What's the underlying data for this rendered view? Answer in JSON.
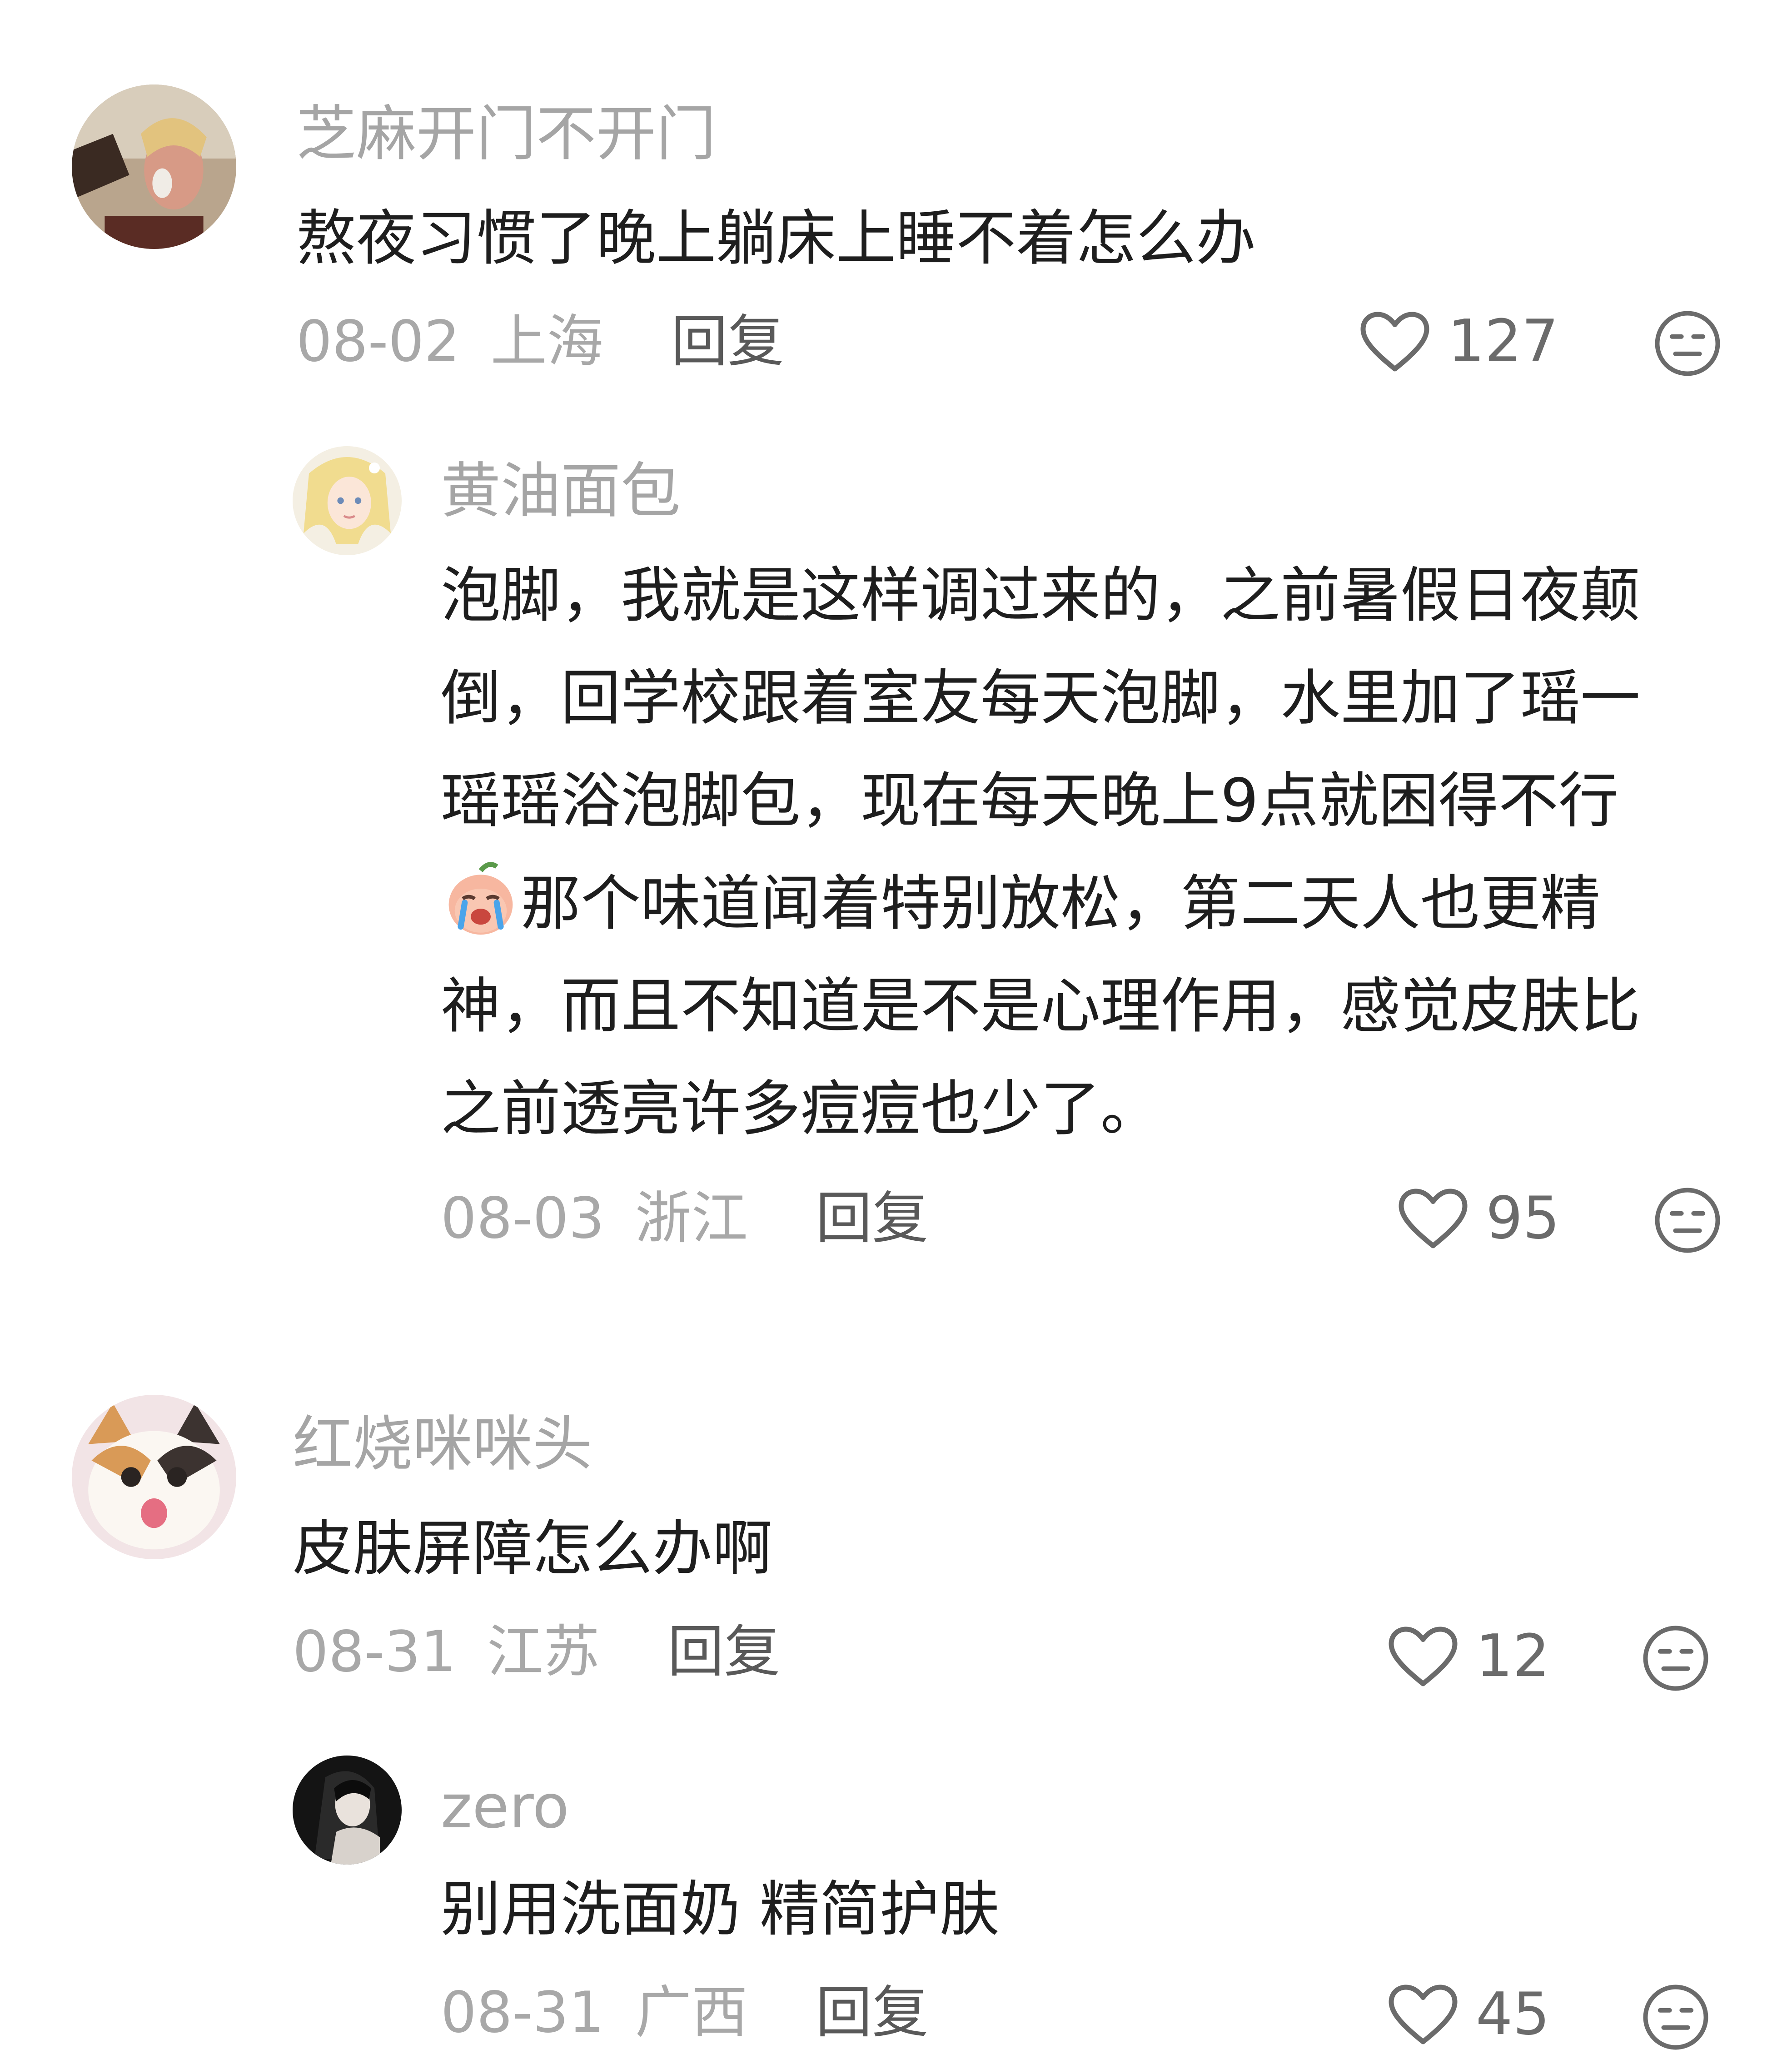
{
  "comments": [
    {
      "username": "芝麻开门不开门",
      "text": "熬夜习惯了晚上躺床上睡不着怎么办",
      "date": "08-02",
      "location": "上海",
      "reply_label": "回复",
      "likes": "127",
      "avatar_icon": "user-avatar-photo",
      "replies": [
        {
          "username": "黄油面包",
          "text_part1": "泡脚，我就是这样调过来的，之前暑假日夜颠倒，回学校跟着室友每天泡脚，水里加了瑶一瑶瑶浴泡脚包，现在每天晚上9点就困得不行",
          "text_part2": "那个味道闻着特别放松，第二天人也更精神，而且不知道是不是心理作用，感觉皮肤比之前透亮许多痘痘也少了。",
          "inline_emoji": "crying-peach-emoji",
          "date": "08-03",
          "location": "浙江",
          "reply_label": "回复",
          "likes": "95",
          "avatar_icon": "anime-girl-avatar"
        }
      ]
    },
    {
      "username": "红烧咪咪头",
      "text": "皮肤屏障怎么办啊",
      "date": "08-31",
      "location": "江苏",
      "reply_label": "回复",
      "likes": "12",
      "avatar_icon": "cat-avatar",
      "replies": [
        {
          "username": "zero",
          "text": "别用洗面奶 精简护肤",
          "date": "08-31",
          "location": "广西",
          "reply_label": "回复",
          "likes": "45",
          "avatar_icon": "dark-photo-avatar"
        }
      ]
    }
  ],
  "colors": {
    "username": "#a5a5a5",
    "content": "#1e1e1e",
    "meta": "#a8a8a8",
    "reply": "#595959",
    "icon": "#6b6b6b"
  }
}
